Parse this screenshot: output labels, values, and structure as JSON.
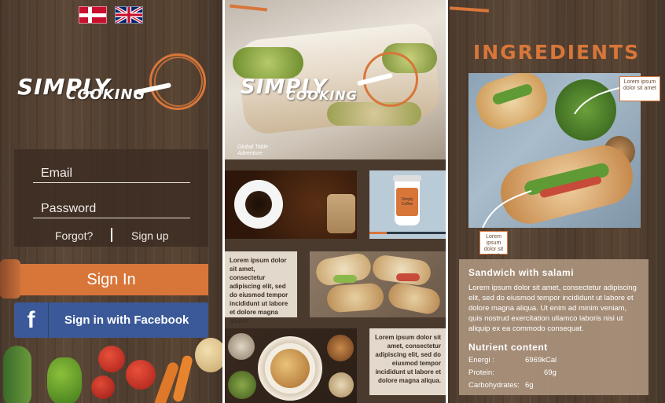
{
  "login": {
    "flags": [
      "danish-flag",
      "uk-flag"
    ],
    "logo": {
      "line1": "SIMPLY",
      "line2": "COOKING"
    },
    "email_placeholder": "Email",
    "password_placeholder": "Password",
    "forgot_label": "Forgot?",
    "signup_label": "Sign up",
    "signin_label": "Sign In",
    "facebook_label": "Sign in with Facebook",
    "facebook_icon": "f"
  },
  "feed": {
    "logo": {
      "line1": "SIMPLY",
      "line2": "COOKING"
    },
    "hero_credit": "Global Table Adventure",
    "lorem_1": "Lorem ipsum dolor sit amet, consectetur adipiscing elit, sed do eiusmod tempor incididunt ut labore et dolore magna aliqua.",
    "lorem_2": "Lorem ipsum dolor sit amet, consectetur adipiscing elit, sed do eiusmod tempor incididunt ut labore et dolore magna aliqua.",
    "cup_label": "Simply Coffee"
  },
  "ingredients": {
    "title": "INGREDIENTS",
    "callout_1": "Lorem ipsum dolor sit amet",
    "callout_2": "Lorem ipsum dolor sit amet",
    "dish_title": "Sandwich with salami",
    "dish_text": "Lorem ipsum dolor sit amet, consectetur adipiscing elit, sed do eiusmod tempor incididunt ut labore et dolore magna aliqua. Ut enim ad minim veniam, quis nostrud exercitation ullamco laboris nisi ut aliquip ex ea commodo consequat.",
    "nutrient_title": "Nutrient content",
    "nutrients": [
      {
        "label": "Energi :",
        "value": "6969kCal"
      },
      {
        "label": "Protein:",
        "value": "69g"
      },
      {
        "label": "Carbohydrates:",
        "value": "6g"
      }
    ]
  },
  "colors": {
    "accent": "#d8763a",
    "facebook": "#3b5998",
    "card": "#aa927c"
  }
}
